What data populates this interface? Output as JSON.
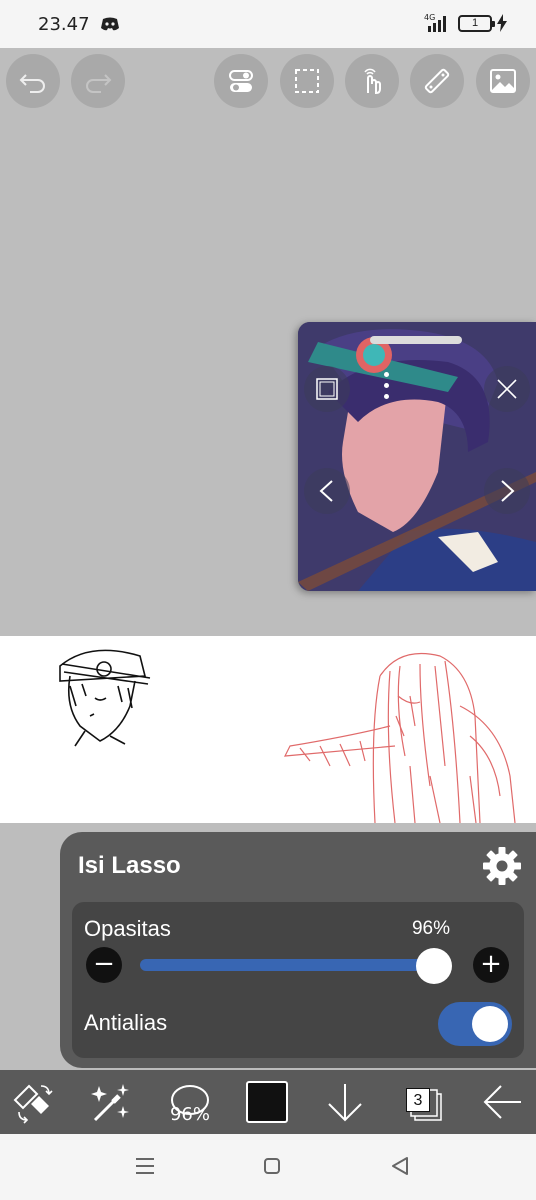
{
  "status_bar": {
    "time": "23.47",
    "network": "4G",
    "battery": "1"
  },
  "top_toolbar": {
    "buttons": [
      "undo-icon",
      "redo-icon",
      "toggle-settings-icon",
      "selection-icon",
      "hand-icon",
      "ruler-icon",
      "image-icon"
    ]
  },
  "reference_window": {
    "buttons": [
      "square-icon",
      "close-icon",
      "previous-icon",
      "next-icon"
    ]
  },
  "fill_lasso_panel": {
    "title": "Isi Lasso",
    "opacity_label": "Opasitas",
    "opacity_value": "96%",
    "opacity_fraction": 0.96,
    "decrease_label": "−",
    "increase_label": "+",
    "antialias_label": "Antialias",
    "antialias_on": true
  },
  "bottom_toolbar": {
    "brush_size": "96%",
    "color": "#111111",
    "layer_count": "3"
  },
  "colors": {
    "accent": "#3866b3",
    "panel": "#5a5a5a",
    "panel_inner": "#454545",
    "canvas_bg": "#bdbdbd"
  }
}
